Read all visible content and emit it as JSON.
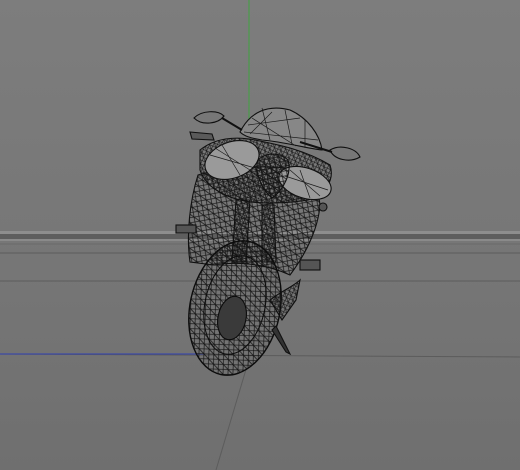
{
  "viewport": {
    "background_top": "#7c7c7c",
    "background_bottom": "#6e6e6e",
    "grid_line_color": "#5a5a5a",
    "horizon_color": "#8c8c8c",
    "axis_y_color": "#3fa33f",
    "axis_x_color": "#2f3fb0"
  },
  "model": {
    "name": "motorcycle-wireframe",
    "wire_color": "#111111",
    "fill_color": "#6a6a6a"
  }
}
